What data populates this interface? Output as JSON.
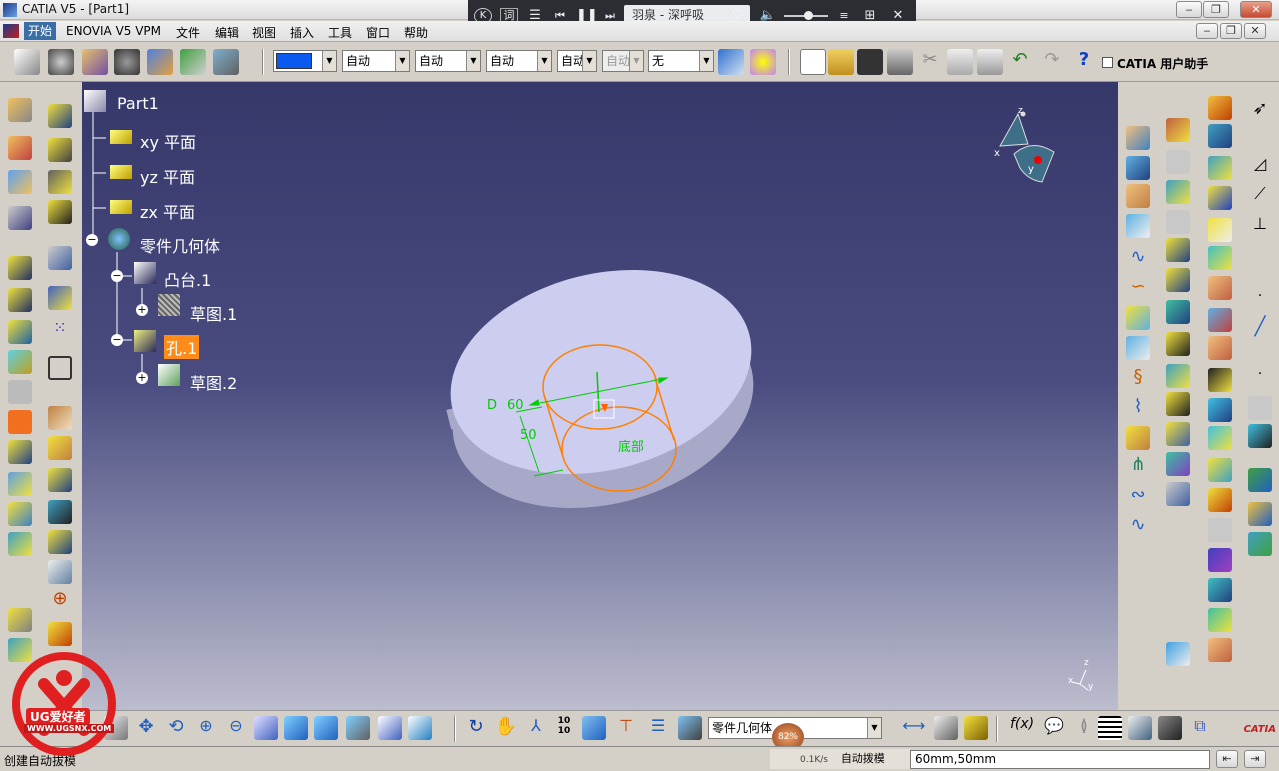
{
  "window": {
    "title": "CATIA V5 - [Part1]"
  },
  "media_player": {
    "song": "羽泉 - 深呼吸",
    "lyrics_label": "词"
  },
  "menu": {
    "items": [
      "开始",
      "ENOVIA V5 VPM",
      "文件",
      "编辑",
      "视图",
      "插入",
      "工具",
      "窗口",
      "帮助"
    ]
  },
  "toolbar": {
    "combo_linetype": "自动",
    "combo_thickness": "自动",
    "combo_point": "自动",
    "combo_layer_short": "自动",
    "combo_disabled": "自动",
    "combo_none": "无",
    "assistant_label": "CATIA 用户助手"
  },
  "tree": {
    "root": "Part1",
    "xy": "xy 平面",
    "yz": "yz 平面",
    "zx": "zx 平面",
    "body": "零件几何体",
    "boss": "凸台.1",
    "sketch1": "草图.1",
    "hole": "孔.1",
    "sketch2": "草图.2"
  },
  "model": {
    "dim_d": "D",
    "dim_d_value": "60",
    "dim_depth": "50",
    "bottom_label": "底部"
  },
  "compass": {
    "x": "x",
    "y": "y",
    "z": "z"
  },
  "bottom_toolbar": {
    "current_body": "零件几何体",
    "cpu": "82%",
    "net_speed": "0.1K/s",
    "auto_scale": "自动拨模"
  },
  "status": {
    "message": "创建自动拔模",
    "command_value": "60mm,50mm"
  },
  "watermark": {
    "brand": "UG爱好者",
    "url": "WWW.UGSNX.COM"
  },
  "colors": {
    "viewport_top": "#36386a",
    "part_face": "#c8c8ec",
    "hole_edge": "#ff8000",
    "dimension": "#00cc00",
    "highlight": "#ff8c1a"
  }
}
